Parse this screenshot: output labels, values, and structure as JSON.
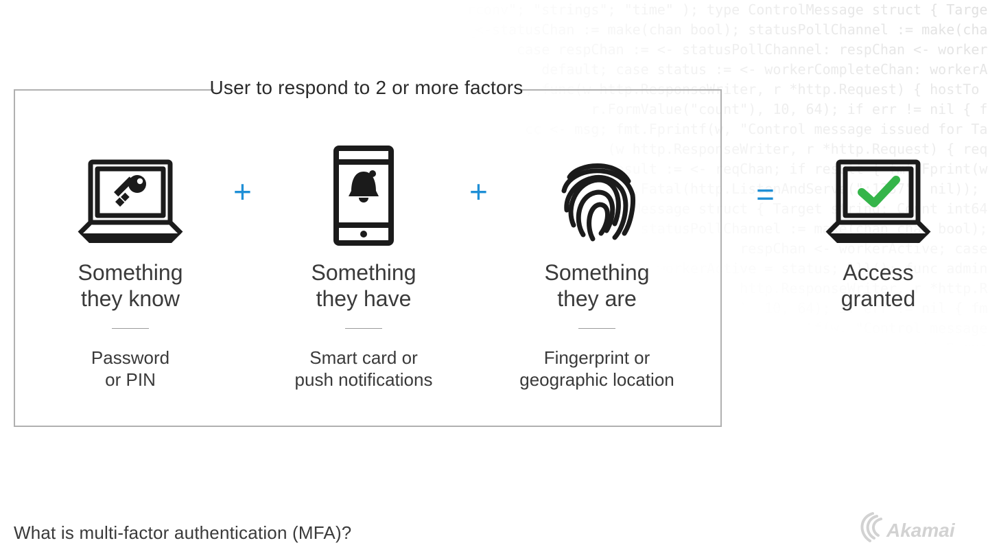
{
  "box_title": "User to respond to 2 or more factors",
  "factors": {
    "know": {
      "title_l1": "Something",
      "title_l2": "they know",
      "sub_l1": "Password",
      "sub_l2": "or PIN"
    },
    "have": {
      "title_l1": "Something",
      "title_l2": "they have",
      "sub_l1": "Smart card or",
      "sub_l2": "push notifications"
    },
    "are": {
      "title_l1": "Something",
      "title_l2": "they are",
      "sub_l1": "Fingerprint or",
      "sub_l2": "geographic location"
    }
  },
  "operators": {
    "plus": "+",
    "equals": "="
  },
  "result": {
    "title_l1": "Access",
    "title_l2": "granted"
  },
  "footer_caption": "What is multi-factor authentication (MFA)?",
  "brand": "Akamai",
  "colors": {
    "accent_blue": "#1f8fd6",
    "check_green": "#35b54a",
    "ink": "#1b1b1b"
  }
}
